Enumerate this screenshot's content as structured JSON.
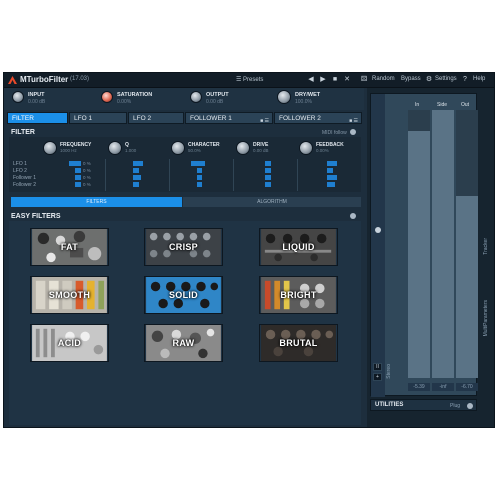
{
  "app": {
    "title": "MTurboFilter",
    "version": "(17.03)"
  },
  "topbar": {
    "presets_label": "☰ Presets",
    "links": [
      "Random",
      "Bypass",
      "Settings",
      "Help"
    ],
    "icons": [
      "prev-icon",
      "next-icon",
      "save-icon",
      "close-icon"
    ]
  },
  "knobs": [
    {
      "label": "INPUT",
      "value": "0.00 dB"
    },
    {
      "label": "SATURATION",
      "value": "0.00%"
    },
    {
      "label": "OUTPUT",
      "value": "0.00 dB"
    },
    {
      "label": "DRY/WET",
      "value": "100.0%"
    }
  ],
  "tabs": [
    "FILTER",
    "LFO 1",
    "LFO 2",
    "FOLLOWER 1",
    "FOLLOWER 2"
  ],
  "filter": {
    "heading": "FILTER",
    "midi_label": "MIDI follow",
    "params": [
      {
        "label": "FREQUENCY",
        "value": "1000 Hz"
      },
      {
        "label": "Q",
        "value": "1.000"
      },
      {
        "label": "CHARACTER",
        "value": "50.0%"
      },
      {
        "label": "DRIVE",
        "value": "0.00 dB"
      },
      {
        "label": "FEEDBACK",
        "value": "0.00%"
      }
    ],
    "mod_rows": [
      "LFO 1",
      "LFO 2",
      "Follower 1",
      "Follower 2"
    ],
    "mod_values": [
      "0 %",
      "0 %",
      "0 %",
      "0 %"
    ]
  },
  "switch": {
    "filters": "FILTERS",
    "algorithm": "ALGORITHM"
  },
  "easy": {
    "heading": "EASY FILTERS",
    "presets": [
      "FAT",
      "CRISP",
      "LIQUID",
      "SMOOTH",
      "SOLID",
      "BRIGHT",
      "ACID",
      "RAW",
      "BRUTAL"
    ]
  },
  "meters": {
    "labels": [
      "In",
      "Side",
      "Out"
    ],
    "values": [
      "-5.39",
      "-inf",
      "-6.70"
    ],
    "levels": [
      0.92,
      0,
      0.68
    ],
    "side_labels": [
      "Tracker",
      "MultiParameters"
    ]
  },
  "utilities": {
    "label": "UTILITIES",
    "value": "Plug",
    "stereo_label": "Stereo"
  }
}
